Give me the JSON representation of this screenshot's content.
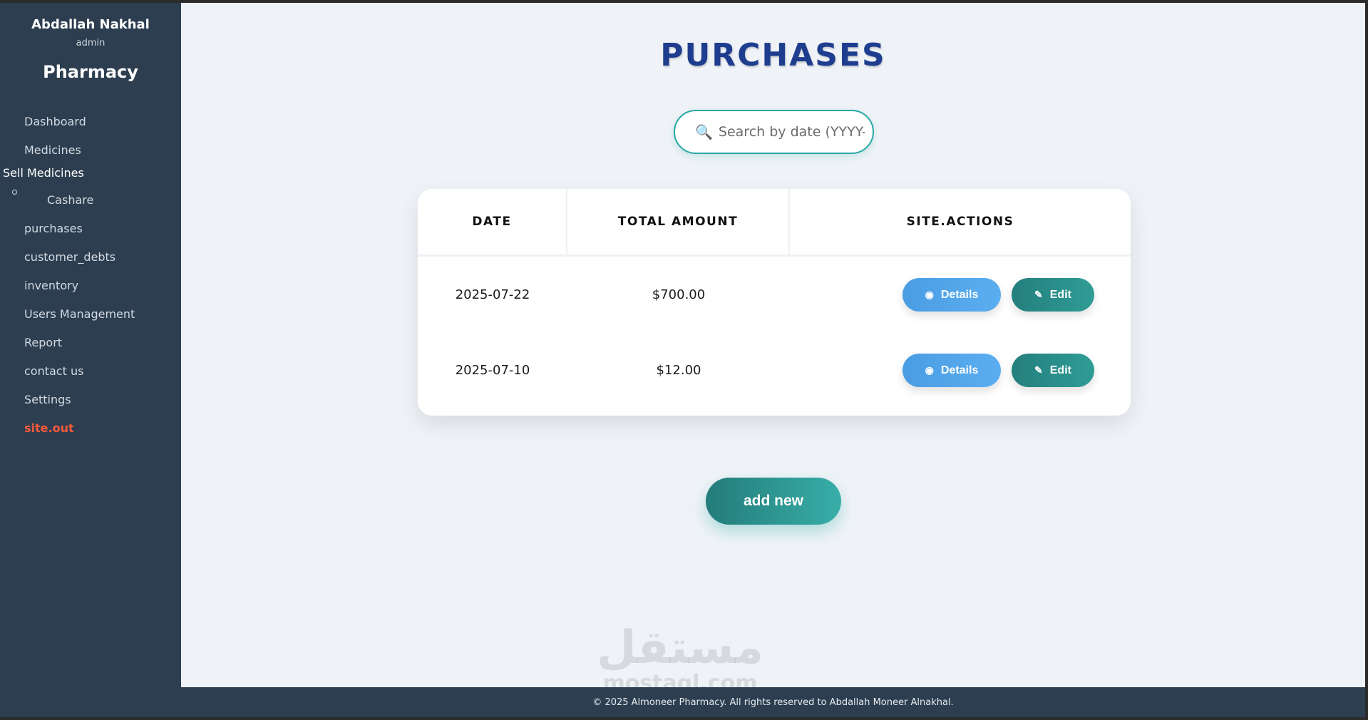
{
  "sidebar": {
    "user_name": "Abdallah Nakhal",
    "user_role": "admin",
    "brand": "Pharmacy",
    "items": {
      "dashboard": "Dashboard",
      "medicines": "Medicines",
      "sell_medicines": "Sell Medicines",
      "cashare": "Cashare",
      "purchases": "purchases",
      "customer_debts": "customer_debts",
      "inventory": "inventory",
      "users_management": "Users Management",
      "report": "Report",
      "contact_us": "contact us",
      "settings": "Settings",
      "logout": "site.out"
    }
  },
  "main": {
    "title": "PURCHASES",
    "search": {
      "icon": "🔍",
      "placeholder": "Search by date (YYYY-MM-DD)"
    },
    "table": {
      "headers": {
        "date": "DATE",
        "total_amount": "TOTAL AMOUNT",
        "actions": "SITE.ACTIONS"
      },
      "rows": [
        {
          "date": "2025-07-22",
          "total": "$700.00",
          "details_label": "Details",
          "edit_label": "Edit"
        },
        {
          "date": "2025-07-10",
          "total": "$12.00",
          "details_label": "Details",
          "edit_label": "Edit"
        }
      ]
    },
    "add_new_label": "add new"
  },
  "watermark": {
    "arabic": "مستقل",
    "latin": "mostaql.com"
  },
  "footer": {
    "text": "© 2025 Almoneer Pharmacy. All rights reserved to Abdallah Moneer Alnakhal."
  },
  "colors": {
    "sidebar_bg": "#2d3e50",
    "main_bg": "#eff3f7",
    "title": "#1e3d8f",
    "accent_teal": "#2aa8a4",
    "details_blue": "#4b9de3",
    "logout_red": "#ff5a3c"
  }
}
